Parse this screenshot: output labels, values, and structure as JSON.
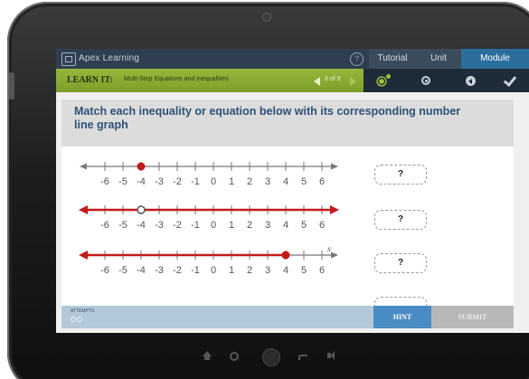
{
  "topbar": {
    "brand": "Apex Learning",
    "help_glyph": "?",
    "tabs": [
      {
        "label": "Tutorial",
        "active": false
      },
      {
        "label": "Unit",
        "active": false
      },
      {
        "label": "Module",
        "active": true
      }
    ]
  },
  "lesson": {
    "learn_label": "LEARN IT:",
    "title": "Multi-Step Equations and Inequalities",
    "pager": "8 of 9"
  },
  "toolbar": {
    "icons": [
      "gear-icon",
      "target-icon",
      "back-icon",
      "check-icon"
    ]
  },
  "question": {
    "text": "Match each inequality or equation below with its corresponding number line graph"
  },
  "number_lines": [
    {
      "ticks": [
        "-6",
        "-5",
        "-4",
        "-3",
        "-2",
        "-1",
        "0",
        "1",
        "2",
        "3",
        "4",
        "5",
        "6"
      ],
      "point": -4,
      "closed": true,
      "ray": "none",
      "variable": ""
    },
    {
      "ticks": [
        "-6",
        "-5",
        "-4",
        "-3",
        "-2",
        "-1",
        "0",
        "1",
        "2",
        "3",
        "4",
        "5",
        "6"
      ],
      "point": -4,
      "closed": false,
      "ray": "both",
      "variable": ""
    },
    {
      "ticks": [
        "-6",
        "-5",
        "-4",
        "-3",
        "-2",
        "-1",
        "0",
        "1",
        "2",
        "3",
        "4",
        "5",
        "6"
      ],
      "point": 4,
      "closed": true,
      "ray": "left",
      "variable": "x"
    }
  ],
  "answers": [
    "?",
    "?",
    "?",
    ""
  ],
  "footer": {
    "attempts_label": "ATTEMPTS",
    "hint_label": "HINT",
    "submit_label": "SUBMIT"
  },
  "colors": {
    "accent_red": "#c41a1a",
    "lesson_green": "#8aac32",
    "topbar": "#2f3f51",
    "active_tab": "#2b6d9b",
    "question_text": "#2d5277"
  }
}
